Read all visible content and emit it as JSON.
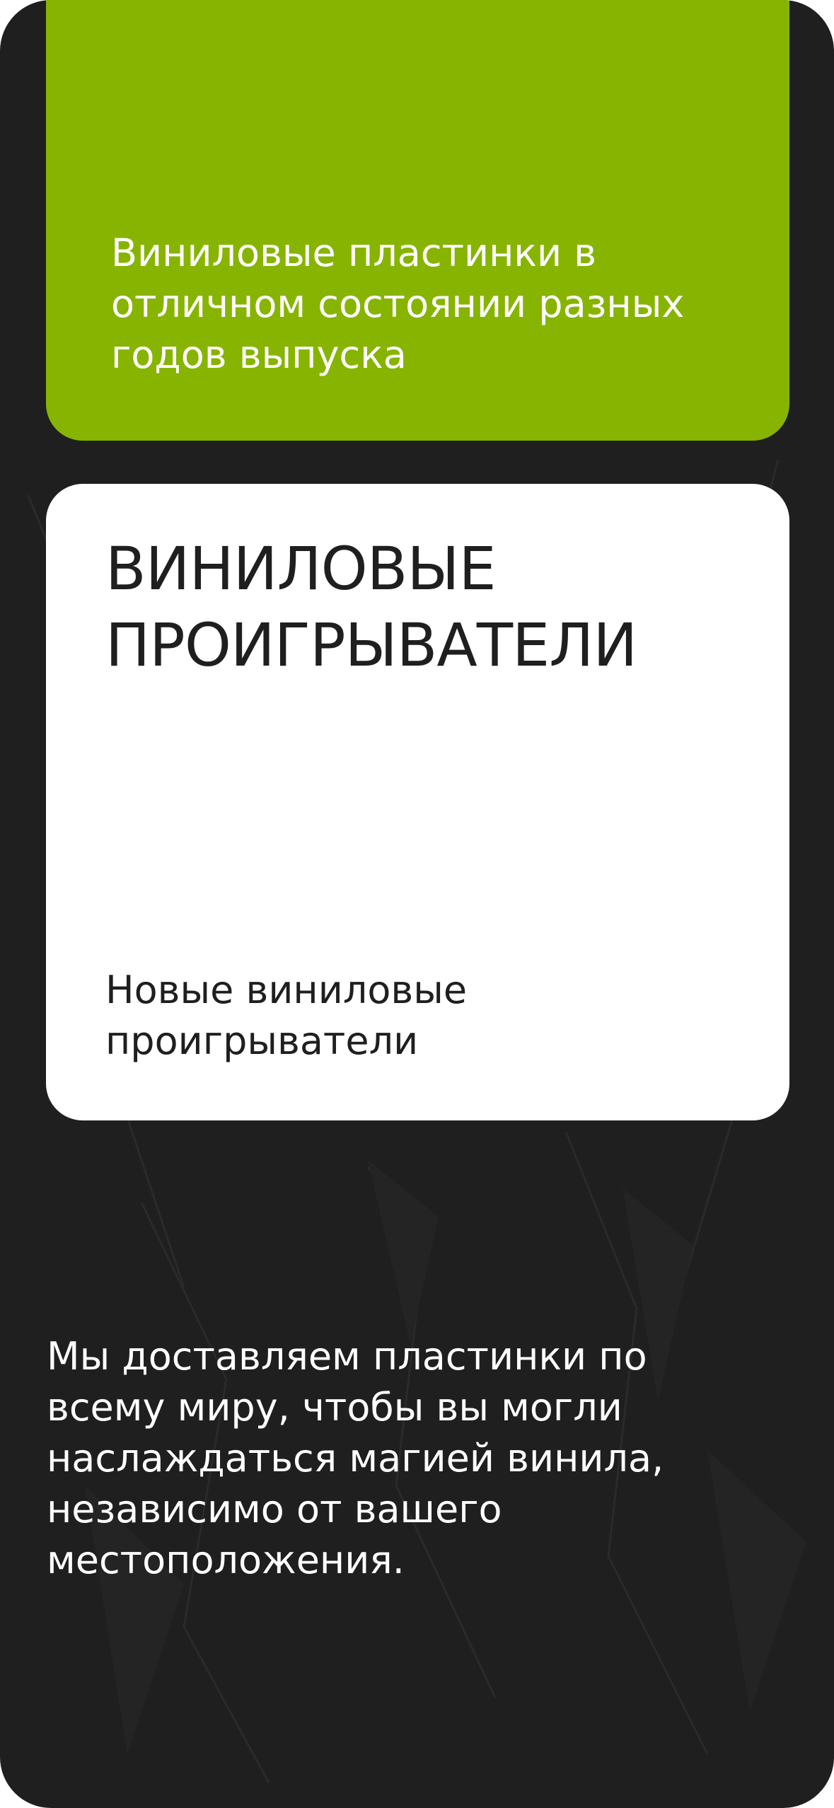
{
  "colors": {
    "background": "#1f1f1f",
    "accent": "#87b400",
    "card": "#ffffff",
    "text_dark": "#1f1f1f",
    "text_light": "#ffffff"
  },
  "green_card": {
    "description": "Виниловые пластинки в отличном состоянии разных годов выпуска"
  },
  "white_card": {
    "title": "Виниловые проигрыватели",
    "subtitle": "Новые виниловые проигрыватели"
  },
  "delivery": {
    "text": "Мы доставляем пластинки по всему миру, чтобы вы могли наслаждаться магией винила, независимо от вашего местоположения."
  }
}
